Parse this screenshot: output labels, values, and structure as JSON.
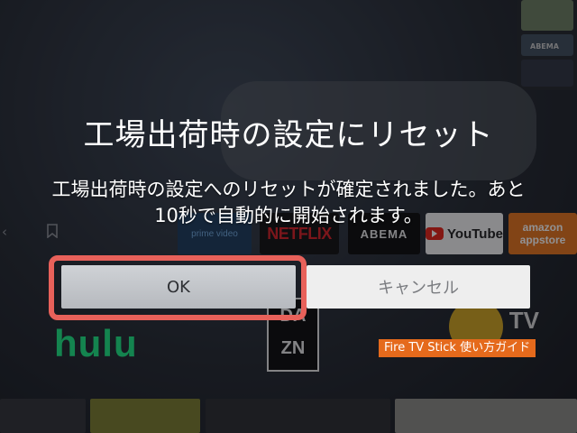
{
  "dialog": {
    "title": "工場出荷時の設定にリセット",
    "message_line1": "工場出荷時の設定へのリセットが確定されました。あと",
    "message_line2": "10秒で自動的に開始されます。",
    "ok_label": "OK",
    "cancel_label": "キャンセル"
  },
  "background": {
    "thumbnail_label": "ABEMA",
    "apps": {
      "prime_video": "prime video",
      "netflix": "NETFLIX",
      "abema": "ABEMA",
      "youtube": "YouTube",
      "amazon_line1": "amazon",
      "amazon_line2": "appstore",
      "hulu": "hulu",
      "dazn_line1": "DA",
      "dazn_line2": "ZN",
      "redbull_tv": "TV"
    }
  },
  "watermark": "Fire TV Stick 使い方ガイド",
  "icons": {
    "nav_left": "back-icon",
    "nav_bookmark": "bookmark-icon",
    "youtube_play": "play-icon"
  },
  "colors": {
    "highlight": "#e8615a",
    "watermark_bg": "#e56a1c",
    "netflix": "#d81f26",
    "hulu": "#1ce783",
    "amazon": "#e3731d"
  }
}
